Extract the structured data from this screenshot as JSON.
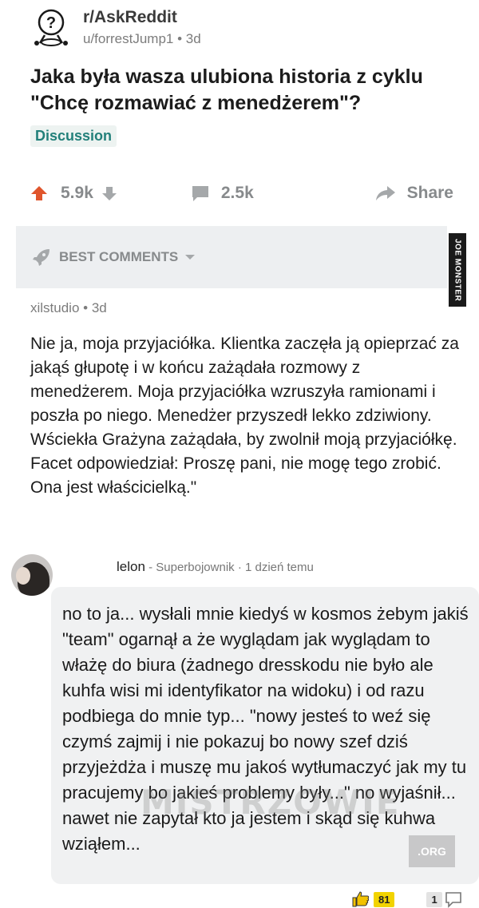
{
  "post": {
    "subreddit": "r/AskReddit",
    "user_time": "u/forrestJump1 • 3d",
    "title": "Jaka była wasza ulubiona historia z cyklu \"Chcę rozmawiać z menedżerem\"?",
    "flair": "Discussion",
    "votes": "5.9k",
    "comments": "2.5k",
    "share_label": "Share"
  },
  "sort_bar": {
    "label": "BEST COMMENTS"
  },
  "watermark_vertical": "JOE MONSTER",
  "top_comment": {
    "author_time": "xilstudio • 3d",
    "body": "Nie ja, moja przyjaciółka. Klientka zaczęła ją opieprzać za jakąś głupotę i w końcu zażądała rozmowy z menedżerem. Moja przyjaciółka wzruszyła ramionami i poszła po niego. Menedżer przyszedł lekko zdziwiony. Wściekła Grażyna zażądała, by zwolnił moją przyjaciółkę. Facet odpowiedział: Proszę pani, nie mogę tego zrobić. Ona jest właścicielką.\""
  },
  "site_comment": {
    "username": "lelon",
    "rank": " - Superbojownik · 1 dzień temu",
    "text": "no to ja... wysłali mnie kiedyś w kosmos żebym jakiś \"team\" ogarnął a że wyglądam jak wyglądam to włażę do biura (żadnego dresskodu nie było ale kuhfa wisi mi identyfikator na widoku) i od razu podbiega do mnie typ... \"nowy jesteś to weź się czymś zajmij i nie pokazuj bo nowy szef dziś przyjeżdża i muszę mu jakoś wytłumaczyć jak my tu pracujemy bo jakieś problemy były...\" no wyjaśnił... nawet nie zapytał kto ja jestem i skąd się kuhwa wziąłem...",
    "likes": "81",
    "replies": "1"
  },
  "site_watermark": {
    "text": "MISTRZOWIE",
    "suffix": ".ORG"
  },
  "colors": {
    "upvote": "#e0552c",
    "flair_text": "#22807a",
    "like_badge": "#f2d300"
  }
}
